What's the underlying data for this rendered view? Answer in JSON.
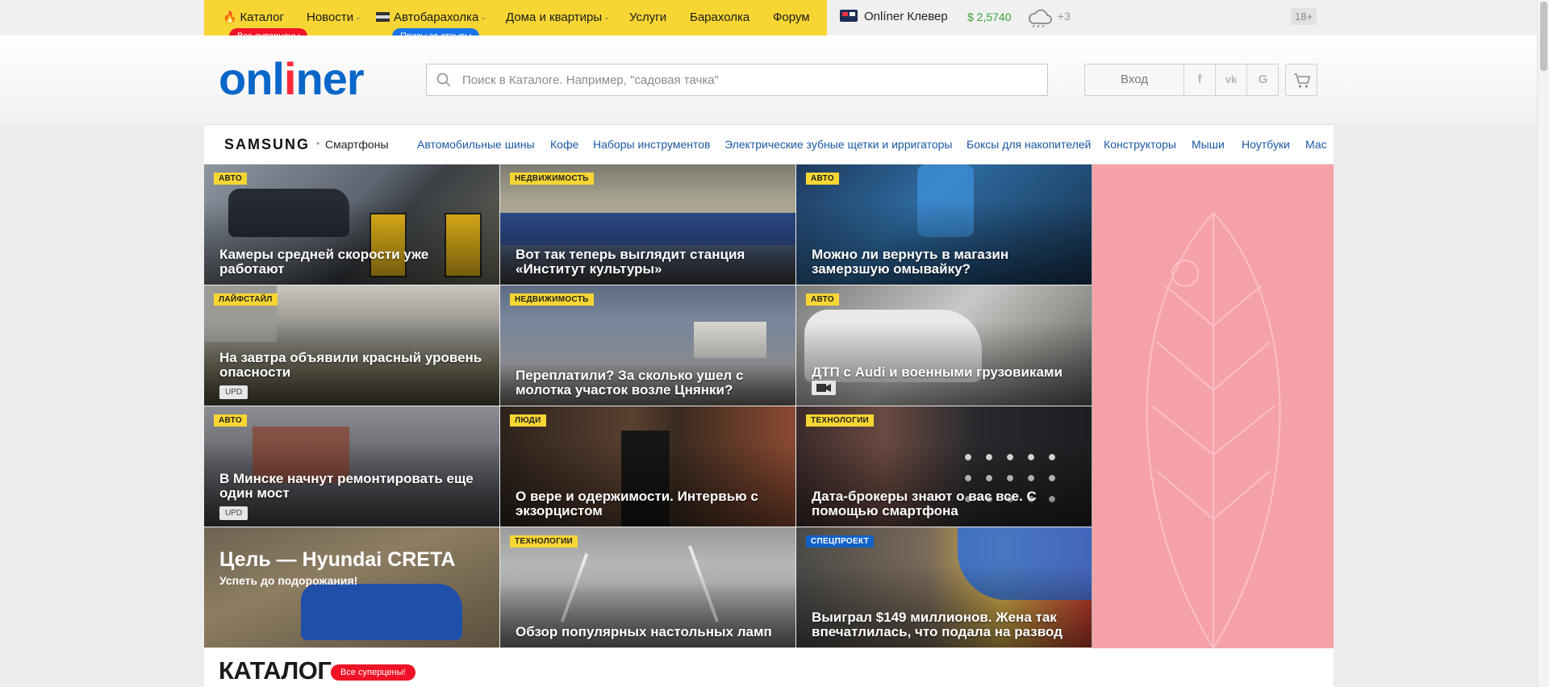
{
  "topnav": {
    "items": [
      {
        "label": "Каталог"
      },
      {
        "label": "Новости"
      },
      {
        "label": "Автобарахолка"
      },
      {
        "label": "Дома и квартиры"
      },
      {
        "label": "Услуги"
      },
      {
        "label": "Барахолка"
      },
      {
        "label": "Форум"
      }
    ],
    "pill_red": "Все суперцены",
    "pill_blue": "Призы за отзывы",
    "klever": "Onlíner Клевер",
    "currency": "$ 2,5740",
    "weather": "+3",
    "age": "18+"
  },
  "header": {
    "logo_left": "onl",
    "logo_accent": "i",
    "logo_right": "ner",
    "search_placeholder": "Поиск в Каталоге. Например, \"садовая тачка\"",
    "login_label": "Вход",
    "social": [
      "f",
      "vk",
      "G"
    ]
  },
  "catbar": {
    "brand": "SAMSUNG",
    "brand_sub": "Смартфоны",
    "links": [
      "Автомобильные шины",
      "Кофе",
      "Наборы инструментов",
      "Электрические зубные щетки и ирригаторы",
      "Боксы для накопителей",
      "Конструкторы",
      "Мыши",
      "Ноутбуки",
      "Мас"
    ]
  },
  "news": [
    {
      "tag": "Авто",
      "title": "Камеры средней скорости уже работают"
    },
    {
      "tag": "Недвижимость",
      "title": "Вот так теперь выглядит станция «Институт культуры»"
    },
    {
      "tag": "Авто",
      "title": "Можно ли вернуть в магазин замерзшую омывайку?"
    },
    {
      "tag": "Лайфстайл",
      "title": "На завтра объявили красный уровень опасности",
      "badge": "UPD"
    },
    {
      "tag": "Недвижимость",
      "title": "Переплатили? За сколько ушел с молотка участок возле Цнянки?"
    },
    {
      "tag": "Авто",
      "title": "ДТП с Audi и военными грузовиками",
      "icon": "video-camera-icon"
    },
    {
      "tag": "Авто",
      "title": "В Минске начнут ремонтировать еще один мост",
      "badge": "UPD"
    },
    {
      "tag": "Люди",
      "title": "О вере и одержимости. Интервью с экзорцистом"
    },
    {
      "tag": "Технологии",
      "title": "Дата-брокеры знают о вас все. С помощью смартфона"
    },
    {
      "promo_title": "Цель — Hyundai CRETA",
      "promo_sub": "Успеть до подорожания!"
    },
    {
      "tag": "Технологии",
      "title": "Обзор популярных настольных ламп"
    },
    {
      "tag": "Спецпроект",
      "title": "Выиграл $149 миллионов. Жена так впечатлилась, что подала на развод"
    }
  ],
  "bottom": {
    "heading": "КАТАЛОГ",
    "pill": "Все суперцены!"
  },
  "colors": {
    "yellow": "#f7d634",
    "brand_blue": "#0a67c9",
    "red": "#f01226",
    "ad_pink": "#f4a2a8"
  }
}
